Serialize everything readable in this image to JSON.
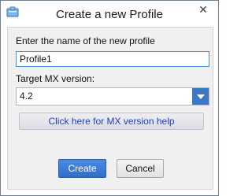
{
  "window": {
    "title": "Create a new Profile",
    "close_symbol": "✕",
    "icon": "app-icon"
  },
  "form": {
    "name_label": "Enter the name of the new profile",
    "name_value": "Profile1",
    "version_label": "Target MX version:",
    "version_selected": "4.2",
    "help_link": "Click here for MX version help"
  },
  "actions": {
    "create_label": "Create",
    "cancel_label": "Cancel"
  },
  "colors": {
    "accent": "#3c78c3",
    "link": "#1f3fc6"
  }
}
